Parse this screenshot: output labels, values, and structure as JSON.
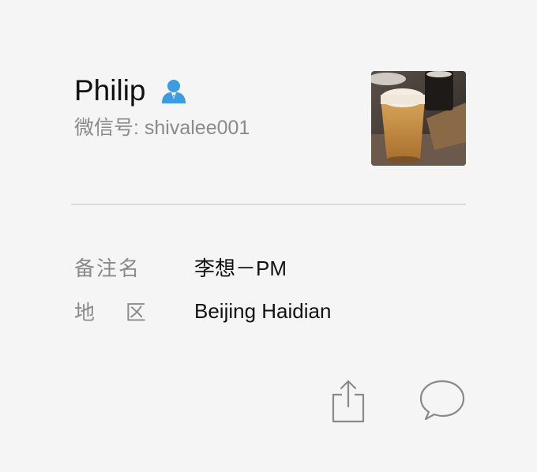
{
  "profile": {
    "name": "Philip",
    "wechat_id": "微信号: shivalee001",
    "gender_icon": "male-user-icon",
    "avatar": "beer-glass-photo"
  },
  "info": {
    "remark_label": "备注名",
    "remark_value": "李想－PM",
    "region_label": "地    区",
    "region_value": "Beijing Haidian"
  },
  "actions": {
    "share_icon": "share-icon",
    "message_icon": "chat-bubble-icon"
  },
  "colors": {
    "background": "#f5f5f5",
    "accent_blue": "#3d9be0",
    "icon_gray": "#8a8a8a"
  }
}
